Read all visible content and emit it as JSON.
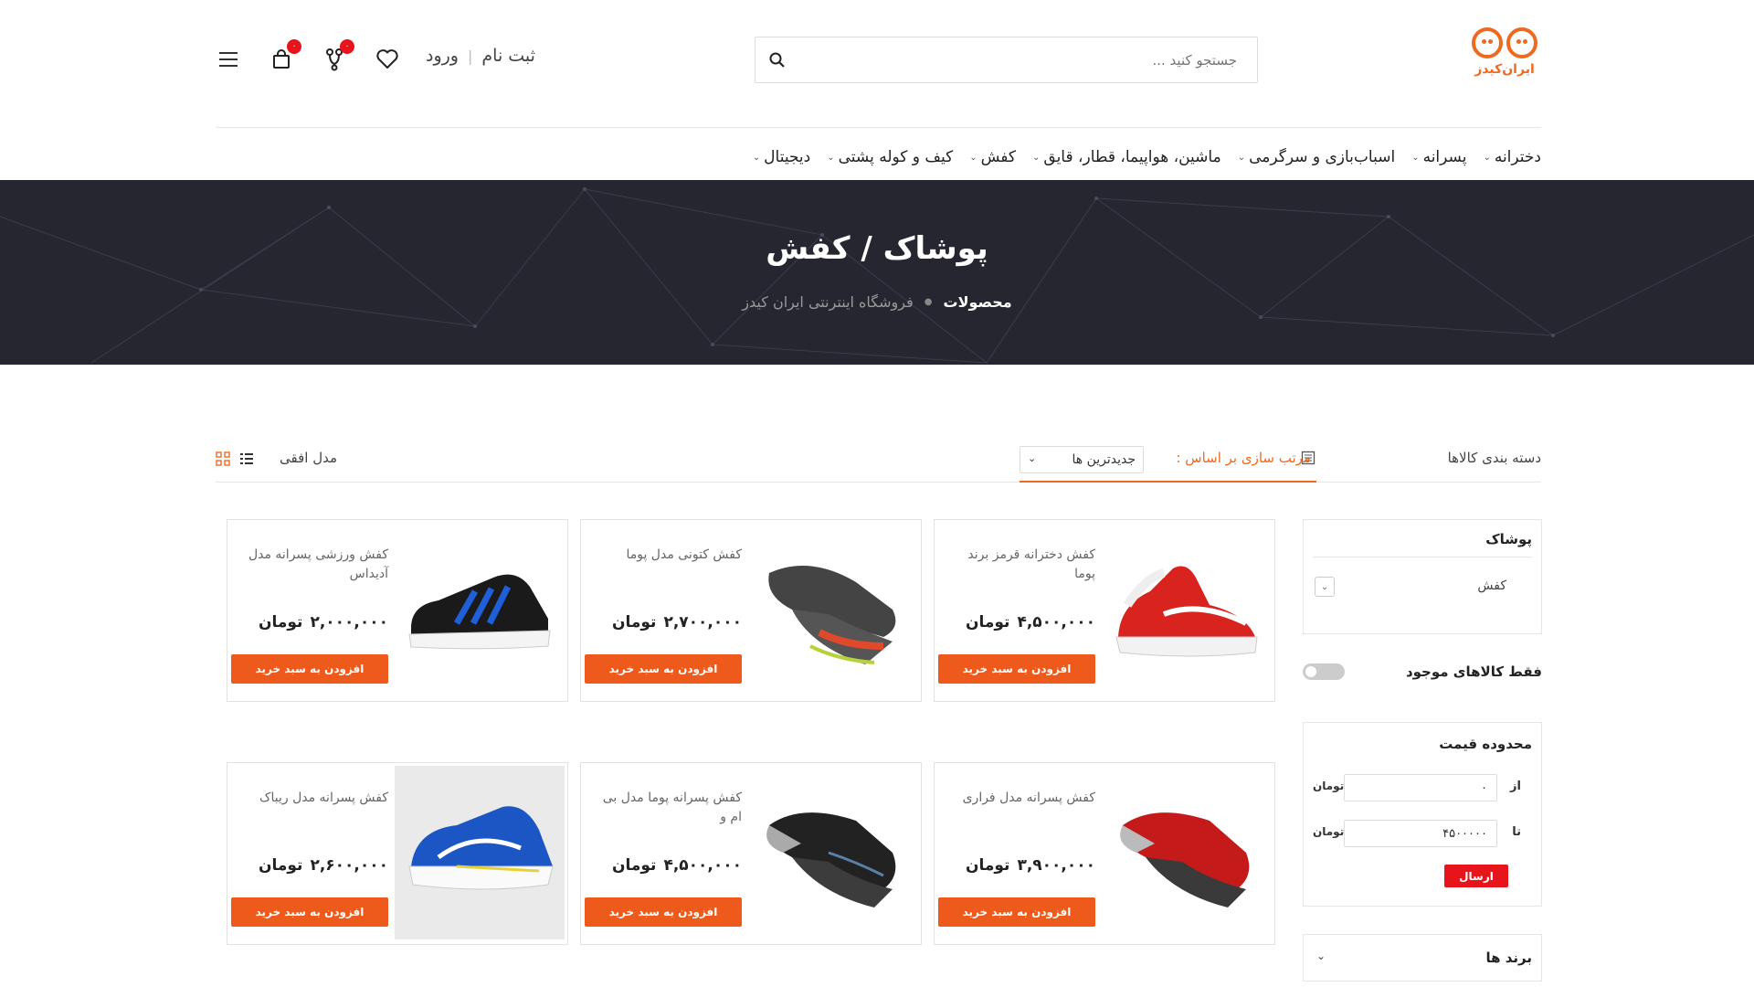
{
  "header": {
    "logo_text": "ایران‌کیدز",
    "search_placeholder": "جستجو کنید ...",
    "register": "ثبت نام",
    "login": "ورود",
    "compare_count": "۰",
    "cart_count": "۰"
  },
  "nav": [
    {
      "label": "دخترانه"
    },
    {
      "label": "پسرانه"
    },
    {
      "label": "اسباب‌بازی و سرگرمی"
    },
    {
      "label": "ماشین، هواپیما، قطار، قایق"
    },
    {
      "label": "کفش"
    },
    {
      "label": "کیف و کوله پشتی"
    },
    {
      "label": "دیجیتال"
    }
  ],
  "banner": {
    "title": "پوشاک / کفش",
    "crumb_current": "محصولات",
    "crumb_home": "فروشگاه اینترنتی ایران کیدز"
  },
  "toolbar": {
    "categories_title": "دسته بندی کالاها",
    "sort_label": "مرتب سازی بر اساس :",
    "sort_value": "جدیدترین ها",
    "view_label": "مدل افقی"
  },
  "sidebar": {
    "category_title": "پوشاک",
    "category_item": "کفش",
    "stock_label": "فقط کالاهای موجود",
    "price_title": "محدوده قیمت",
    "from_label": "از",
    "to_label": "تا",
    "from_value": "۰",
    "to_value": "۴۵۰۰۰۰۰",
    "unit": "تومان",
    "send": "ارسال",
    "brands_title": "برند ها"
  },
  "products": [
    {
      "name": "کفش دخترانه قرمز برند پوما",
      "price": "۴,۵۰۰,۰۰۰",
      "currency": "تومان",
      "button": "افزودن به سبد خرید",
      "color": "#d9231f"
    },
    {
      "name": "کفش کتونی مدل پوما",
      "price": "۲,۷۰۰,۰۰۰",
      "currency": "تومان",
      "button": "افزودن به سبد خرید",
      "color": "#444444"
    },
    {
      "name": "کفش ورزشی پسرانه مدل آدیداس",
      "price": "۲,۰۰۰,۰۰۰",
      "currency": "تومان",
      "button": "افزودن به سبد خرید",
      "color": "#1a1a1a"
    },
    {
      "name": "کفش پسرانه مدل فراری",
      "price": "۳,۹۰۰,۰۰۰",
      "currency": "تومان",
      "button": "افزودن به سبد خرید",
      "color": "#c41a1a"
    },
    {
      "name": "کفش پسرانه پوما مدل بی ام و",
      "price": "۴,۵۰۰,۰۰۰",
      "currency": "تومان",
      "button": "افزودن به سبد خرید",
      "color": "#222222"
    },
    {
      "name": "کفش پسرانه مدل ریباک",
      "price": "۲,۶۰۰,۰۰۰",
      "currency": "تومان",
      "button": "افزودن به سبد خرید",
      "color": "#1c56c4"
    }
  ]
}
